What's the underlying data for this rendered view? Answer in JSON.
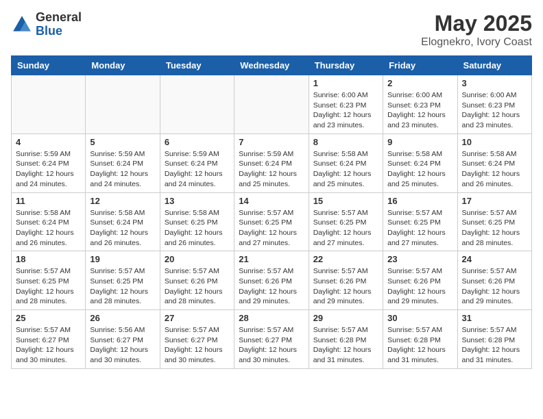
{
  "header": {
    "logo_general": "General",
    "logo_blue": "Blue",
    "month": "May 2025",
    "location": "Elognekro, Ivory Coast"
  },
  "weekdays": [
    "Sunday",
    "Monday",
    "Tuesday",
    "Wednesday",
    "Thursday",
    "Friday",
    "Saturday"
  ],
  "weeks": [
    [
      {
        "day": "",
        "info": ""
      },
      {
        "day": "",
        "info": ""
      },
      {
        "day": "",
        "info": ""
      },
      {
        "day": "",
        "info": ""
      },
      {
        "day": "1",
        "info": "Sunrise: 6:00 AM\nSunset: 6:23 PM\nDaylight: 12 hours\nand 23 minutes."
      },
      {
        "day": "2",
        "info": "Sunrise: 6:00 AM\nSunset: 6:23 PM\nDaylight: 12 hours\nand 23 minutes."
      },
      {
        "day": "3",
        "info": "Sunrise: 6:00 AM\nSunset: 6:23 PM\nDaylight: 12 hours\nand 23 minutes."
      }
    ],
    [
      {
        "day": "4",
        "info": "Sunrise: 5:59 AM\nSunset: 6:24 PM\nDaylight: 12 hours\nand 24 minutes."
      },
      {
        "day": "5",
        "info": "Sunrise: 5:59 AM\nSunset: 6:24 PM\nDaylight: 12 hours\nand 24 minutes."
      },
      {
        "day": "6",
        "info": "Sunrise: 5:59 AM\nSunset: 6:24 PM\nDaylight: 12 hours\nand 24 minutes."
      },
      {
        "day": "7",
        "info": "Sunrise: 5:59 AM\nSunset: 6:24 PM\nDaylight: 12 hours\nand 25 minutes."
      },
      {
        "day": "8",
        "info": "Sunrise: 5:58 AM\nSunset: 6:24 PM\nDaylight: 12 hours\nand 25 minutes."
      },
      {
        "day": "9",
        "info": "Sunrise: 5:58 AM\nSunset: 6:24 PM\nDaylight: 12 hours\nand 25 minutes."
      },
      {
        "day": "10",
        "info": "Sunrise: 5:58 AM\nSunset: 6:24 PM\nDaylight: 12 hours\nand 26 minutes."
      }
    ],
    [
      {
        "day": "11",
        "info": "Sunrise: 5:58 AM\nSunset: 6:24 PM\nDaylight: 12 hours\nand 26 minutes."
      },
      {
        "day": "12",
        "info": "Sunrise: 5:58 AM\nSunset: 6:24 PM\nDaylight: 12 hours\nand 26 minutes."
      },
      {
        "day": "13",
        "info": "Sunrise: 5:58 AM\nSunset: 6:25 PM\nDaylight: 12 hours\nand 26 minutes."
      },
      {
        "day": "14",
        "info": "Sunrise: 5:57 AM\nSunset: 6:25 PM\nDaylight: 12 hours\nand 27 minutes."
      },
      {
        "day": "15",
        "info": "Sunrise: 5:57 AM\nSunset: 6:25 PM\nDaylight: 12 hours\nand 27 minutes."
      },
      {
        "day": "16",
        "info": "Sunrise: 5:57 AM\nSunset: 6:25 PM\nDaylight: 12 hours\nand 27 minutes."
      },
      {
        "day": "17",
        "info": "Sunrise: 5:57 AM\nSunset: 6:25 PM\nDaylight: 12 hours\nand 28 minutes."
      }
    ],
    [
      {
        "day": "18",
        "info": "Sunrise: 5:57 AM\nSunset: 6:25 PM\nDaylight: 12 hours\nand 28 minutes."
      },
      {
        "day": "19",
        "info": "Sunrise: 5:57 AM\nSunset: 6:25 PM\nDaylight: 12 hours\nand 28 minutes."
      },
      {
        "day": "20",
        "info": "Sunrise: 5:57 AM\nSunset: 6:26 PM\nDaylight: 12 hours\nand 28 minutes."
      },
      {
        "day": "21",
        "info": "Sunrise: 5:57 AM\nSunset: 6:26 PM\nDaylight: 12 hours\nand 29 minutes."
      },
      {
        "day": "22",
        "info": "Sunrise: 5:57 AM\nSunset: 6:26 PM\nDaylight: 12 hours\nand 29 minutes."
      },
      {
        "day": "23",
        "info": "Sunrise: 5:57 AM\nSunset: 6:26 PM\nDaylight: 12 hours\nand 29 minutes."
      },
      {
        "day": "24",
        "info": "Sunrise: 5:57 AM\nSunset: 6:26 PM\nDaylight: 12 hours\nand 29 minutes."
      }
    ],
    [
      {
        "day": "25",
        "info": "Sunrise: 5:57 AM\nSunset: 6:27 PM\nDaylight: 12 hours\nand 30 minutes."
      },
      {
        "day": "26",
        "info": "Sunrise: 5:56 AM\nSunset: 6:27 PM\nDaylight: 12 hours\nand 30 minutes."
      },
      {
        "day": "27",
        "info": "Sunrise: 5:57 AM\nSunset: 6:27 PM\nDaylight: 12 hours\nand 30 minutes."
      },
      {
        "day": "28",
        "info": "Sunrise: 5:57 AM\nSunset: 6:27 PM\nDaylight: 12 hours\nand 30 minutes."
      },
      {
        "day": "29",
        "info": "Sunrise: 5:57 AM\nSunset: 6:28 PM\nDaylight: 12 hours\nand 31 minutes."
      },
      {
        "day": "30",
        "info": "Sunrise: 5:57 AM\nSunset: 6:28 PM\nDaylight: 12 hours\nand 31 minutes."
      },
      {
        "day": "31",
        "info": "Sunrise: 5:57 AM\nSunset: 6:28 PM\nDaylight: 12 hours\nand 31 minutes."
      }
    ]
  ]
}
